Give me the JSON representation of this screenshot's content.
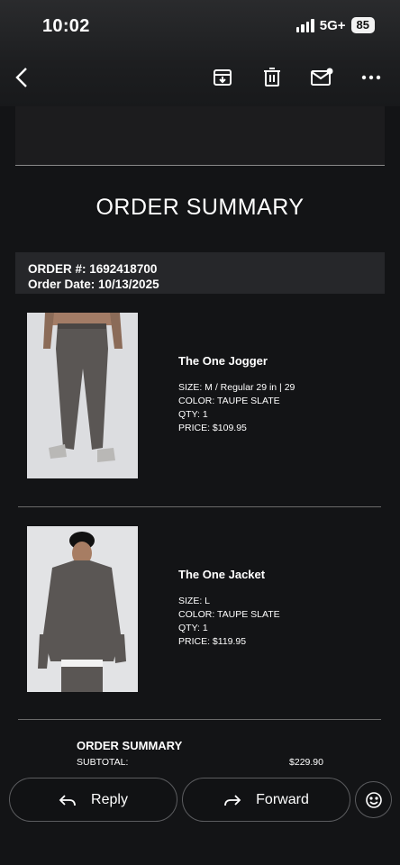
{
  "status_bar": {
    "time": "10:02",
    "network": "5G+",
    "battery": "85"
  },
  "toolbar": {
    "icons": [
      "back-icon",
      "archive-icon",
      "trash-icon",
      "mark-unread-icon",
      "more-icon"
    ]
  },
  "email": {
    "title": "ORDER SUMMARY",
    "order_number": "ORDER #: 1692418700",
    "order_date": "Order Date: 10/13/2025",
    "items": [
      {
        "name": "The One Jogger",
        "size": "SIZE: M / Regular 29 in | 29",
        "color": "COLOR: TAUPE SLATE",
        "qty": "QTY: 1",
        "price": "PRICE: $109.95"
      },
      {
        "name": "The One Jacket",
        "size": "SIZE: L",
        "color": "COLOR: TAUPE SLATE",
        "qty": "QTY: 1",
        "price": "PRICE: $119.95"
      }
    ],
    "summary": {
      "title": "ORDER SUMMARY",
      "subtotal_label": "SUBTOTAL:",
      "subtotal_value": "$229.90"
    }
  },
  "actions": {
    "reply": "Reply",
    "forward": "Forward"
  },
  "colors": {
    "background": "#131416",
    "product_gray": "#5a5654"
  }
}
